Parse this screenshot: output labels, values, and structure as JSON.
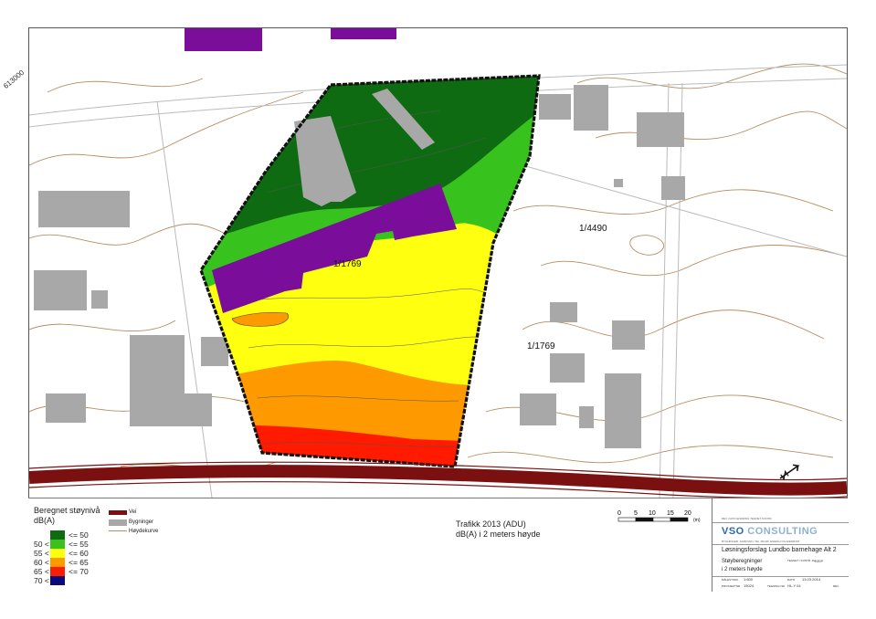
{
  "map": {
    "coordinate_label": "613000",
    "parcels": [
      "1/4490",
      "1/1769",
      "1/1769"
    ],
    "colors": {
      "le_50": "#0f6b12",
      "le_55": "#38c21e",
      "le_60": "#ffff10",
      "le_65": "#ff9900",
      "le_70": "#ff1a00",
      "gt_70": "#0a0a7a",
      "road": "#7a1010",
      "building": "#a8a8a8",
      "contour": "#b98d5e",
      "purple_building": "#7a0e9a"
    },
    "north_arrow": "north-arrow-icon"
  },
  "legend": {
    "title": "Beregnet støynivå dB(A)",
    "rows": [
      {
        "prefix": "",
        "label": "<= 50"
      },
      {
        "prefix": "50 <",
        "label": "<= 55"
      },
      {
        "prefix": "55 <",
        "label": "<= 60"
      },
      {
        "prefix": "60 <",
        "label": "<= 65"
      },
      {
        "prefix": "65 <",
        "label": "<= 70"
      },
      {
        "prefix": "70 <",
        "label": ""
      }
    ],
    "symbols": [
      {
        "name": "road-symbol",
        "label": "Vei"
      },
      {
        "name": "building-symbol",
        "label": "Bygninger"
      },
      {
        "name": "contour-symbol",
        "label": "Høydekurve"
      }
    ]
  },
  "traffic": {
    "line1": "Trafikk 2013 (ADU)",
    "line2": "dB(A) i 2 meters høyde"
  },
  "scale": {
    "ticks": [
      "0",
      "5",
      "10",
      "15",
      "20"
    ],
    "unit": "(m)"
  },
  "titleblock": {
    "header_small": "REV.   DATO   ENDRING   TEGNET   KONTR.",
    "logo_main": "VSO",
    "logo_sub": "CONSULTING",
    "logo_tagline": "BYGNINGER, SAMFUNN, VEI, MILJØ, ENERGI OG EIENDOM",
    "project": "Løsningsforslag Lundbo barnehage Alt 2",
    "subtitle1": "Støyberegninger",
    "subtitle2": "i 2 meters høyde",
    "drawn_label": "TEGNET / KONTR. AV:",
    "drawn": "KEIP",
    "scale_label": "MÅLESTOKK",
    "scale": "1:600",
    "date_label": "DATO",
    "date": "13.03.2014",
    "project_no_label": "PROSJEKTNR.",
    "project_no": "15024",
    "drawing_no_label": "TEGNING NR.",
    "drawing_no": "HL-Y 04",
    "rev_label": "REV."
  }
}
